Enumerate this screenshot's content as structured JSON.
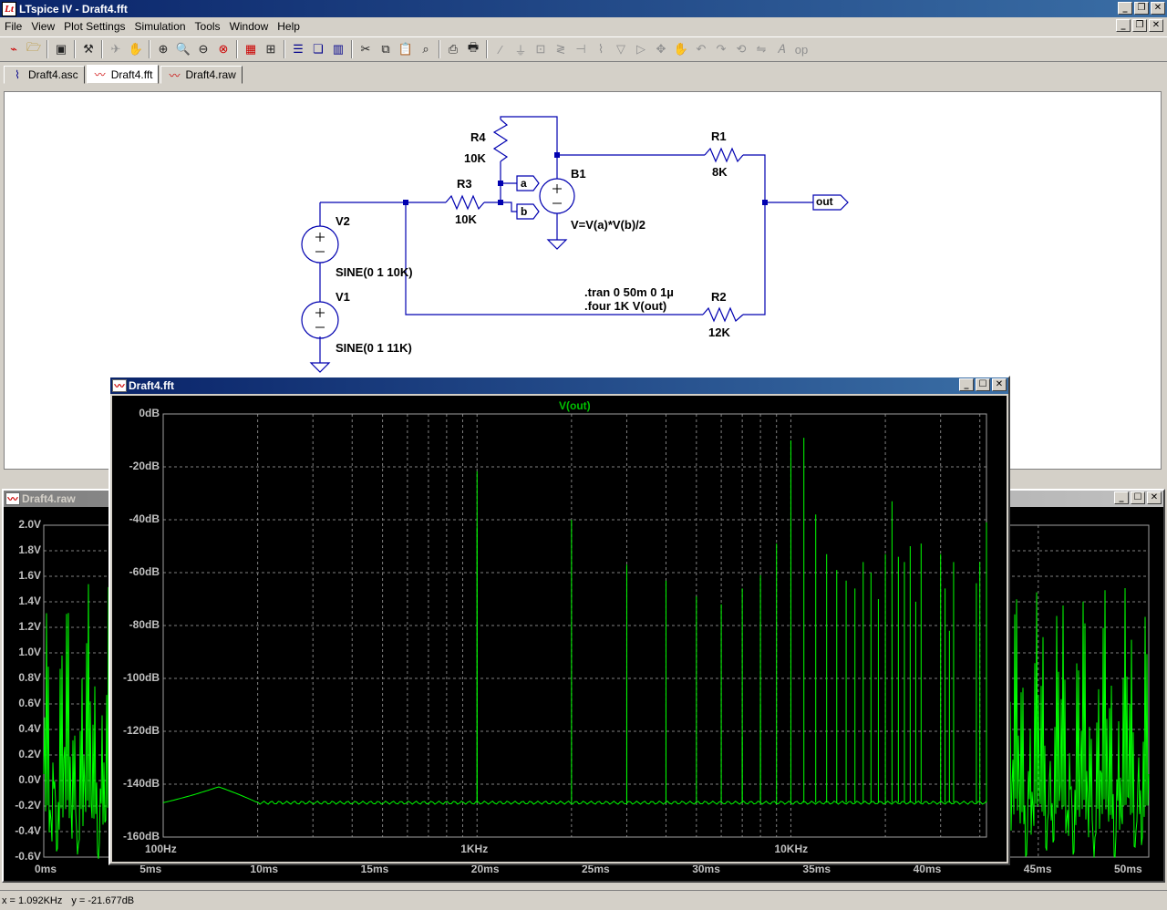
{
  "app": {
    "title": "LTspice IV - Draft4.fft"
  },
  "menu": [
    "File",
    "View",
    "Plot Settings",
    "Simulation",
    "Tools",
    "Window",
    "Help"
  ],
  "toolbar_icons": [
    "new-schematic-icon",
    "open-icon",
    "save-icon",
    "control-panel-icon",
    "run-icon",
    "halt-icon",
    "zoom-in-icon",
    "zoom-out-icon",
    "zoom-full-icon",
    "zoom-cancel-icon",
    "autorange-icon",
    "add-trace-icon",
    "tile-horizontal-icon",
    "cascade-icon",
    "tile-vertical-icon",
    "cut-icon",
    "copy-icon",
    "paste-icon",
    "find-icon",
    "print-preview-icon",
    "print-icon",
    "wire-icon",
    "ground-icon",
    "label-net-icon",
    "resistor-icon",
    "capacitor-icon",
    "inductor-icon",
    "diode-icon",
    "component-icon",
    "move-icon",
    "drag-icon",
    "undo-icon",
    "redo-icon",
    "rotate-icon",
    "mirror-icon",
    "text-icon",
    "spice-directive-icon"
  ],
  "tabs": [
    {
      "label": "Draft4.asc",
      "icon": "schematic-icon",
      "active": false
    },
    {
      "label": "Draft4.fft",
      "icon": "waveform-icon",
      "active": true
    },
    {
      "label": "Draft4.raw",
      "icon": "waveform-icon",
      "active": false
    }
  ],
  "schematic": {
    "R4": {
      "name": "R4",
      "value": "10K"
    },
    "R3": {
      "name": "R3",
      "value": "10K"
    },
    "R1": {
      "name": "R1",
      "value": "8K"
    },
    "R2": {
      "name": "R2",
      "value": "12K"
    },
    "B1": {
      "name": "B1",
      "expr": "V=V(a)*V(b)/2"
    },
    "V2": {
      "name": "V2",
      "value": "SINE(0 1 10K)"
    },
    "V1": {
      "name": "V1",
      "value": "SINE(0 1 11K)"
    },
    "net_a": "a",
    "net_b": "b",
    "net_out": "out",
    "directive1": ".tran 0 50m 0 1µ",
    "directive2": ".four 1K V(out)"
  },
  "raw_window": {
    "title": "Draft4.raw",
    "y_ticks": [
      "2.0V",
      "1.8V",
      "1.6V",
      "1.4V",
      "1.2V",
      "1.0V",
      "0.8V",
      "0.6V",
      "0.4V",
      "0.2V",
      "0.0V",
      "-0.2V",
      "-0.4V",
      "-0.6V"
    ],
    "x_ticks": [
      "0ms",
      "5ms",
      "10ms",
      "15ms",
      "20ms",
      "25ms",
      "30ms",
      "35ms",
      "40ms",
      "45ms",
      "50ms"
    ]
  },
  "fft_window": {
    "title": "Draft4.fft",
    "trace": "V(out)",
    "trace_color": "#00ff00",
    "grid_color": "#808080"
  },
  "chart_data": {
    "type": "line",
    "title": "",
    "series": [
      {
        "name": "V(out)",
        "color": "#00ff00"
      }
    ],
    "xscale": "log",
    "xlim": [
      100,
      42000
    ],
    "x_ticks": [
      "100Hz",
      "1KHz",
      "10KHz"
    ],
    "ylim": [
      -160,
      0
    ],
    "y_ticks": [
      "0dB",
      "-20dB",
      "-40dB",
      "-60dB",
      "-80dB",
      "-100dB",
      "-120dB",
      "-140dB",
      "-160dB"
    ],
    "grid": true,
    "floor_db": -147,
    "peaks": [
      {
        "f": 1000,
        "db": -21.7
      },
      {
        "f": 1000,
        "db": -43
      },
      {
        "f": 2000,
        "db": -40
      },
      {
        "f": 3000,
        "db": -57
      },
      {
        "f": 3000,
        "db": -100
      },
      {
        "f": 4000,
        "db": -63
      },
      {
        "f": 4000,
        "db": -109
      },
      {
        "f": 5000,
        "db": -69
      },
      {
        "f": 6000,
        "db": -72
      },
      {
        "f": 7000,
        "db": -66
      },
      {
        "f": 7000,
        "db": -122
      },
      {
        "f": 8000,
        "db": -61
      },
      {
        "f": 8000,
        "db": -110
      },
      {
        "f": 9000,
        "db": -49
      },
      {
        "f": 10000,
        "db": -10
      },
      {
        "f": 11000,
        "db": -9
      },
      {
        "f": 12000,
        "db": -38
      },
      {
        "f": 13000,
        "db": -53
      },
      {
        "f": 14000,
        "db": -59
      },
      {
        "f": 15000,
        "db": -63
      },
      {
        "f": 16000,
        "db": -66
      },
      {
        "f": 17000,
        "db": -56
      },
      {
        "f": 18000,
        "db": -60
      },
      {
        "f": 19000,
        "db": -70
      },
      {
        "f": 20000,
        "db": -53
      },
      {
        "f": 21000,
        "db": -33
      },
      {
        "f": 22000,
        "db": -54
      },
      {
        "f": 23000,
        "db": -56
      },
      {
        "f": 24000,
        "db": -50
      },
      {
        "f": 25000,
        "db": -71
      },
      {
        "f": 26000,
        "db": -49
      },
      {
        "f": 30000,
        "db": -53
      },
      {
        "f": 31000,
        "db": -66
      },
      {
        "f": 32000,
        "db": -82
      },
      {
        "f": 33000,
        "db": -56
      },
      {
        "f": 39000,
        "db": -64
      },
      {
        "f": 40000,
        "db": -56
      },
      {
        "f": 42000,
        "db": -41
      }
    ]
  },
  "status": {
    "x": "x = 1.092KHz",
    "y": "y = -21.677dB"
  }
}
